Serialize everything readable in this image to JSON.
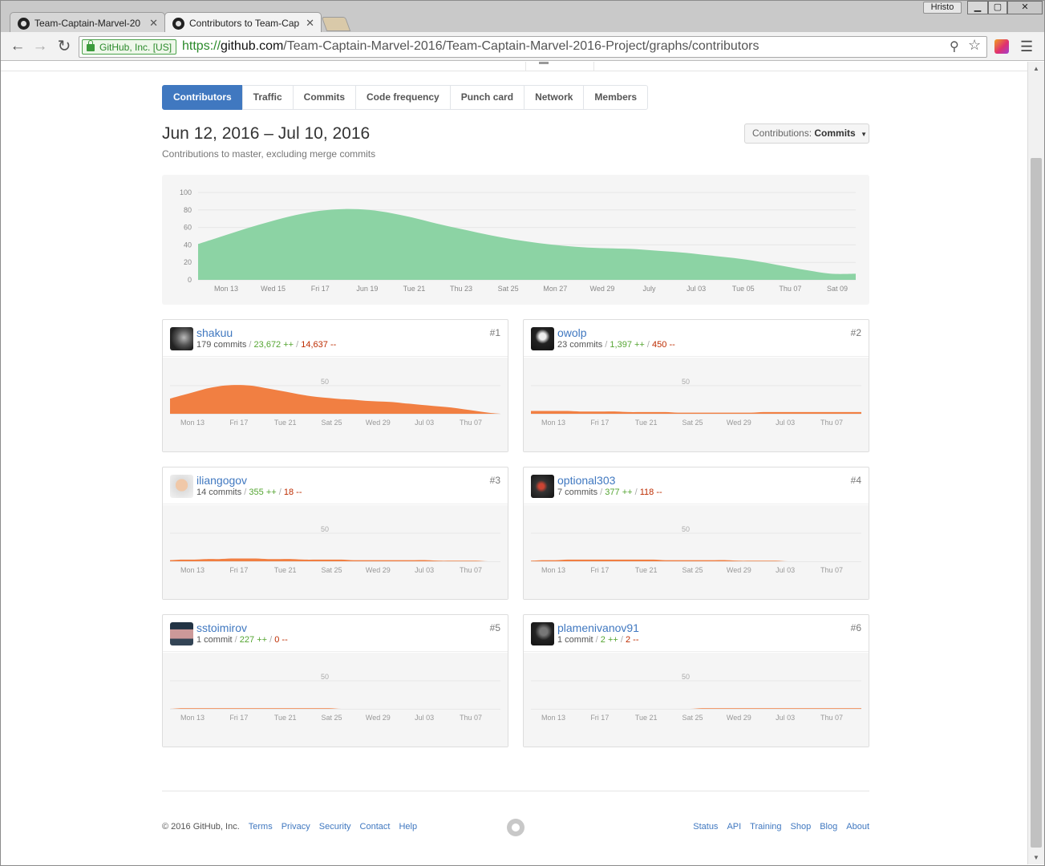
{
  "browser": {
    "tabs": [
      {
        "title": "Team-Captain-Marvel-20",
        "active": false
      },
      {
        "title": "Contributors to Team-Cap",
        "active": true
      }
    ],
    "user_badge": "Hristo",
    "security_chip": "GitHub, Inc. [US]",
    "url": {
      "scheme": "https://",
      "host": "github.com",
      "path": "/Team-Captain-Marvel-2016/Team-Captain-Marvel-2016-Project/graphs/contributors"
    }
  },
  "subnav": {
    "items": [
      {
        "label": "Contributors",
        "selected": true
      },
      {
        "label": "Traffic",
        "selected": false
      },
      {
        "label": "Commits",
        "selected": false
      },
      {
        "label": "Code frequency",
        "selected": false
      },
      {
        "label": "Punch card",
        "selected": false
      },
      {
        "label": "Network",
        "selected": false
      },
      {
        "label": "Members",
        "selected": false
      }
    ]
  },
  "range": {
    "title": "Jun 12, 2016 – Jul 10, 2016",
    "subtitle": "Contributions to master, excluding merge commits"
  },
  "contrib_select": {
    "label": "Contributions:",
    "value": "Commits"
  },
  "colors": {
    "accent": "#4078c0",
    "main_area": "#8cd3a4",
    "contrib_area": "#f17f42",
    "additions": "#55a532",
    "deletions": "#bd2c00"
  },
  "chart_data": [
    {
      "type": "area",
      "title": "",
      "x": [
        "Jun 13",
        "Jun 14",
        "Jun 15",
        "Jun 16",
        "Jun 17",
        "Jun 18",
        "Jun 19",
        "Jun 20",
        "Jun 21",
        "Jun 22",
        "Jun 23",
        "Jun 24",
        "Jun 25",
        "Jun 26",
        "Jun 27",
        "Jun 28",
        "Jun 29",
        "Jun 30",
        "Jul 01",
        "Jul 02",
        "Jul 03",
        "Jul 04",
        "Jul 05",
        "Jul 06",
        "Jul 07",
        "Jul 08",
        "Jul 09",
        "Jul 10"
      ],
      "series": [
        {
          "values": [
            41,
            50,
            59,
            67,
            74,
            79,
            81,
            80,
            76,
            70,
            63,
            57,
            51,
            46,
            42,
            39,
            37,
            36,
            35,
            33,
            31,
            28,
            25,
            21,
            16,
            11,
            7,
            7
          ]
        }
      ],
      "xticks": [
        "Mon 13",
        "Wed 15",
        "Fri 17",
        "Jun 19",
        "Tue 21",
        "Thu 23",
        "Sat 25",
        "Mon 27",
        "Wed 29",
        "July",
        "Jul 03",
        "Tue 05",
        "Thu 07",
        "Sat 09"
      ],
      "yticks": [
        0,
        20,
        40,
        60,
        80,
        100
      ],
      "ylim": [
        0,
        100
      ],
      "grid": true
    },
    {
      "type": "area",
      "xticks": [
        "Mon 13",
        "Fri 17",
        "Tue 21",
        "Sat 25",
        "Wed 29",
        "Jul 03",
        "Thu 07"
      ],
      "ylim": [
        0,
        100
      ],
      "ytick": 50,
      "contributors": [
        {
          "rank": "#1",
          "login": "shakuu",
          "commits": "179 commits",
          "additions": "23,672 ++",
          "deletions": "14,637 --",
          "values": [
            27,
            33,
            39,
            45,
            49,
            51,
            51,
            49,
            45,
            41,
            37,
            33,
            30,
            28,
            26,
            25,
            23,
            22,
            21,
            19,
            17,
            15,
            13,
            11,
            8,
            5,
            2,
            0
          ]
        },
        {
          "rank": "#2",
          "login": "owolp",
          "commits": "23 commits",
          "additions": "1,397 ++",
          "deletions": "450 --",
          "values": [
            5,
            5,
            5,
            5,
            4,
            4,
            4,
            4,
            3,
            3,
            3,
            3,
            2,
            2,
            2,
            2,
            2,
            2,
            2,
            3,
            3,
            3,
            3,
            3,
            3,
            3,
            3,
            3
          ]
        },
        {
          "rank": "#3",
          "login": "iliangogov",
          "commits": "14 commits",
          "additions": "355 ++",
          "deletions": "18 --",
          "values": [
            2,
            3,
            3,
            4,
            4,
            5,
            5,
            5,
            4,
            4,
            4,
            3,
            3,
            3,
            3,
            2,
            2,
            2,
            2,
            2,
            2,
            2,
            1,
            1,
            1,
            1,
            0,
            0
          ]
        },
        {
          "rank": "#4",
          "login": "optional303",
          "commits": "7 commits",
          "additions": "377 ++",
          "deletions": "118 --",
          "values": [
            1,
            2,
            2,
            3,
            3,
            3,
            3,
            3,
            3,
            3,
            3,
            2,
            2,
            2,
            2,
            2,
            2,
            1,
            1,
            1,
            1,
            0,
            0,
            0,
            0,
            0,
            0,
            0
          ]
        },
        {
          "rank": "#5",
          "login": "sstoimirov",
          "commits": "1 commit",
          "additions": "227 ++",
          "deletions": "0 --",
          "values": [
            0,
            1,
            1,
            1,
            1,
            1,
            1,
            1,
            1,
            1,
            1,
            1,
            1,
            1,
            0,
            0,
            0,
            0,
            0,
            0,
            0,
            0,
            0,
            0,
            0,
            0,
            0,
            0
          ]
        },
        {
          "rank": "#6",
          "login": "plamenivanov91",
          "commits": "1 commit",
          "additions": "2 ++",
          "deletions": "2 --",
          "values": [
            0,
            0,
            0,
            0,
            0,
            0,
            0,
            0,
            0,
            0,
            0,
            0,
            0,
            0,
            1,
            1,
            1,
            1,
            1,
            1,
            1,
            1,
            1,
            1,
            1,
            1,
            1,
            1
          ]
        }
      ]
    }
  ],
  "footer": {
    "copyright": "© 2016 GitHub, Inc.",
    "left_links": [
      "Terms",
      "Privacy",
      "Security",
      "Contact",
      "Help"
    ],
    "right_links": [
      "Status",
      "API",
      "Training",
      "Shop",
      "Blog",
      "About"
    ]
  }
}
